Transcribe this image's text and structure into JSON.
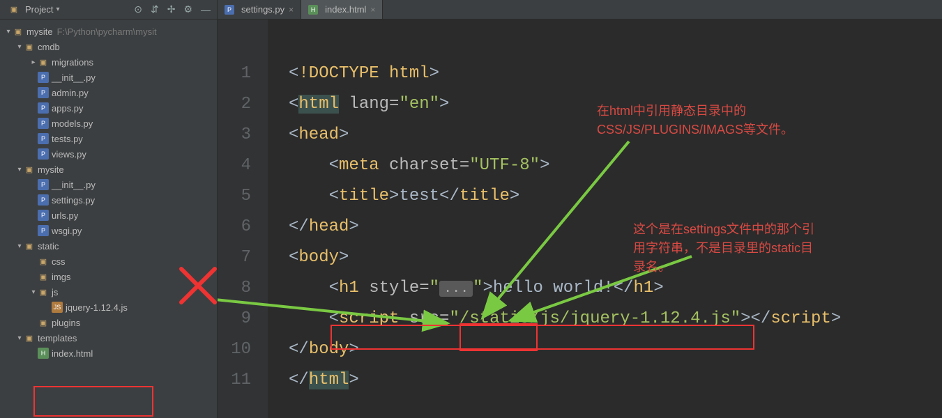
{
  "sidebar": {
    "title": "Project",
    "tools": [
      "⊙",
      "⇵",
      "✢",
      "⚙",
      "—"
    ],
    "root": {
      "name": "mysite",
      "path": "F:\\Python\\pycharm\\mysit"
    },
    "tree": [
      {
        "depth": 0,
        "kind": "folder-open",
        "arrow": "down",
        "label": "mysite",
        "extra": "F:\\Python\\pycharm\\mysit"
      },
      {
        "depth": 1,
        "kind": "pkg",
        "arrow": "down",
        "label": "cmdb"
      },
      {
        "depth": 2,
        "kind": "pkg",
        "arrow": "right",
        "label": "migrations"
      },
      {
        "depth": 2,
        "kind": "py",
        "arrow": "none",
        "label": "__init__.py"
      },
      {
        "depth": 2,
        "kind": "py",
        "arrow": "none",
        "label": "admin.py"
      },
      {
        "depth": 2,
        "kind": "py",
        "arrow": "none",
        "label": "apps.py"
      },
      {
        "depth": 2,
        "kind": "py",
        "arrow": "none",
        "label": "models.py"
      },
      {
        "depth": 2,
        "kind": "py",
        "arrow": "none",
        "label": "tests.py"
      },
      {
        "depth": 2,
        "kind": "py",
        "arrow": "none",
        "label": "views.py"
      },
      {
        "depth": 1,
        "kind": "pkg",
        "arrow": "down",
        "label": "mysite"
      },
      {
        "depth": 2,
        "kind": "py",
        "arrow": "none",
        "label": "__init__.py"
      },
      {
        "depth": 2,
        "kind": "py",
        "arrow": "none",
        "label": "settings.py"
      },
      {
        "depth": 2,
        "kind": "py",
        "arrow": "none",
        "label": "urls.py"
      },
      {
        "depth": 2,
        "kind": "py",
        "arrow": "none",
        "label": "wsgi.py"
      },
      {
        "depth": 1,
        "kind": "folder",
        "arrow": "down",
        "label": "static"
      },
      {
        "depth": 2,
        "kind": "folder",
        "arrow": "none",
        "label": "css"
      },
      {
        "depth": 2,
        "kind": "folder",
        "arrow": "none",
        "label": "imgs"
      },
      {
        "depth": 2,
        "kind": "folder",
        "arrow": "down",
        "label": "js"
      },
      {
        "depth": 3,
        "kind": "js",
        "arrow": "none",
        "label": "jquery-1.12.4.js"
      },
      {
        "depth": 2,
        "kind": "folder",
        "arrow": "none",
        "label": "plugins"
      },
      {
        "depth": 1,
        "kind": "folder",
        "arrow": "down",
        "label": "templates"
      },
      {
        "depth": 2,
        "kind": "html",
        "arrow": "none",
        "label": "index.html"
      }
    ]
  },
  "tabs": [
    {
      "icon": "py",
      "label": "settings.py",
      "active": false
    },
    {
      "icon": "html",
      "label": "index.html",
      "active": true
    }
  ],
  "code": {
    "line_count": 11,
    "lines": [
      {
        "n": 1,
        "html": "<span class='c-txt'>&lt;</span><span class='c-doctype'>!DOCTYPE html</span><span class='c-txt'>&gt;</span>"
      },
      {
        "n": 2,
        "html": "<span class='c-txt'>&lt;</span><span class='c-tag hl-tag'>html</span> <span class='c-attr'>lang=</span><span class='c-str'>\"en\"</span><span class='c-txt'>&gt;</span>"
      },
      {
        "n": 3,
        "html": "<span class='c-txt'>&lt;</span><span class='c-tag'>head</span><span class='c-txt'>&gt;</span>"
      },
      {
        "n": 4,
        "html": "    <span class='c-txt'>&lt;</span><span class='c-tag'>meta</span> <span class='c-attr'>charset=</span><span class='c-str'>\"UTF-8\"</span><span class='c-txt'>&gt;</span>"
      },
      {
        "n": 5,
        "html": "    <span class='c-txt'>&lt;</span><span class='c-tag'>title</span><span class='c-txt'>&gt;</span><span class='c-txt'>test</span><span class='c-txt'>&lt;/</span><span class='c-tag'>title</span><span class='c-txt'>&gt;</span>"
      },
      {
        "n": 6,
        "html": "<span class='c-txt'>&lt;/</span><span class='c-tag'>head</span><span class='c-txt'>&gt;</span>"
      },
      {
        "n": 7,
        "html": "<span class='c-txt'>&lt;</span><span class='c-tag'>body</span><span class='c-txt'>&gt;</span>"
      },
      {
        "n": 8,
        "html": "    <span class='c-txt'>&lt;</span><span class='c-tag'>h1</span> <span class='c-attr'>style=</span><span class='c-str'>\"</span><span class='fold-pill'>...</span><span class='c-str'>\"</span><span class='c-txt'>&gt;</span><span class='c-txt'>hello world!</span><span class='c-txt'>&lt;/</span><span class='c-tag'>h1</span><span class='c-txt'>&gt;</span>"
      },
      {
        "n": 9,
        "html": "    <span class='c-txt'>&lt;</span><span class='c-tag'>script</span> <span class='c-attr'>src=</span><span class='c-str'>\"/static/js/jquery-1.12.4.js\"</span><span class='c-txt'>&gt;&lt;/</span><span class='c-tag'>script</span><span class='c-txt'>&gt;</span>"
      },
      {
        "n": 10,
        "html": "<span class='c-txt'>&lt;/</span><span class='c-tag'>body</span><span class='c-txt'>&gt;</span>"
      },
      {
        "n": 11,
        "html": "<span class='c-txt'>&lt;/</span><span class='c-tag hl-tag'>html</span><span class='c-txt'>&gt;</span>"
      }
    ]
  },
  "annotations": {
    "note1": "在html中引用静态目录中的\nCSS/JS/PLUGINS/IMAGS等文件。",
    "note2": "这个是在settings文件中的那个引\n用字符串，不是目录里的static目\n录名。"
  }
}
